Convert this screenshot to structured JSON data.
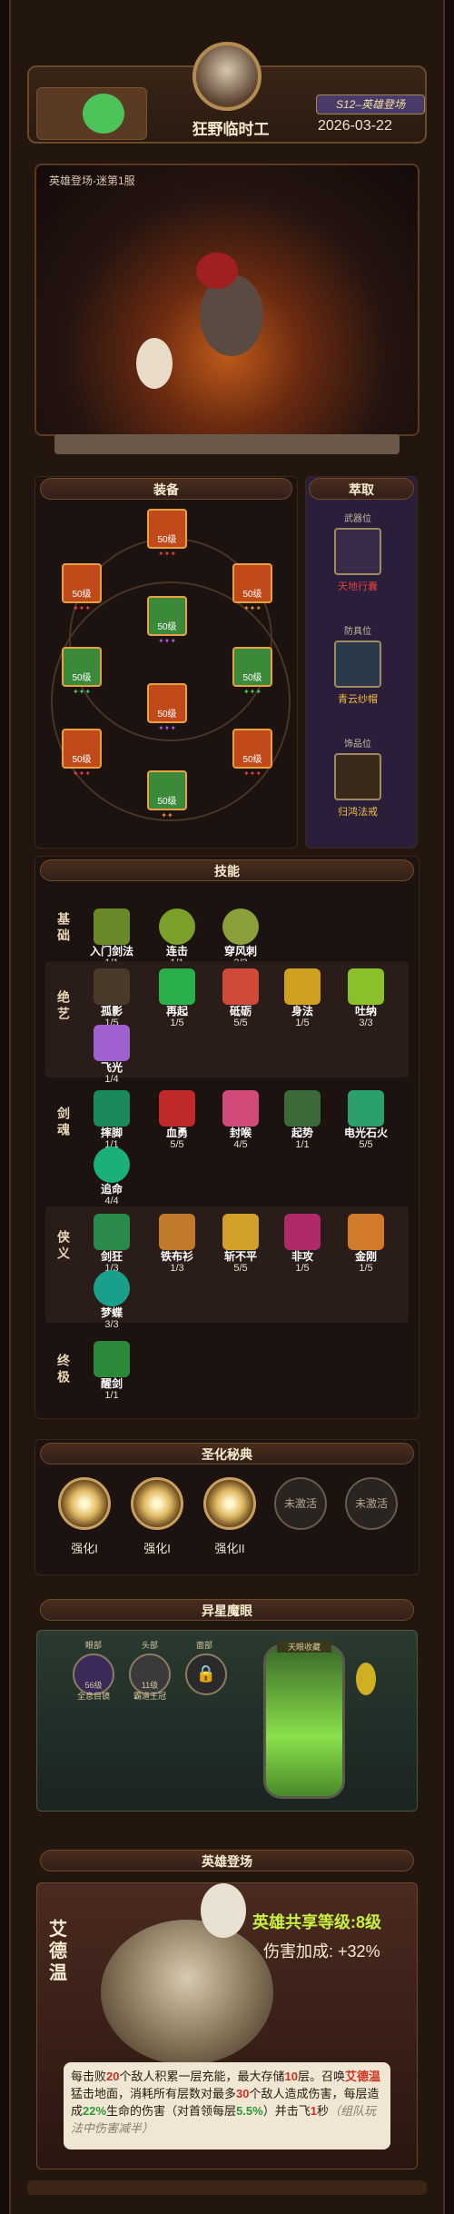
{
  "header": {
    "player_name": "狂野临时工",
    "date": "2026-03-22",
    "season_badge": "S12–英雄登场"
  },
  "stage": {
    "label": "英雄登场-迷第1服"
  },
  "equipment": {
    "title": "装备",
    "slots": [
      {
        "level": "50级",
        "gems": "✦✦✦",
        "gem_color": "red"
      },
      {
        "level": "50级",
        "gems": "✦✦✦",
        "gem_color": "red"
      },
      {
        "level": "50级",
        "gems": "✦✦✦",
        "gem_color": "orange"
      },
      {
        "level": "50级",
        "gems": "✦✦✦",
        "gem_color": "purple"
      },
      {
        "level": "50级",
        "gems": "✦✦✦",
        "gem_color": "green"
      },
      {
        "level": "50级",
        "gems": "✦✦✦",
        "gem_color": "green"
      },
      {
        "level": "50级",
        "gems": "✦✦✦",
        "gem_color": "purple"
      },
      {
        "level": "50级",
        "gems": "✦✦✦",
        "gem_color": "red"
      },
      {
        "level": "50级",
        "gems": "✦✦✦",
        "gem_color": "red"
      },
      {
        "level": "50级",
        "gems": "✦✦",
        "gem_color": "orange"
      }
    ]
  },
  "extract": {
    "title": "萃取",
    "items": [
      {
        "slot": "武器位",
        "name": "天地行囊"
      },
      {
        "slot": "防具位",
        "name": "青云纱帽"
      },
      {
        "slot": "饰品位",
        "name": "归鸿法戒"
      }
    ]
  },
  "skills": {
    "title": "技能",
    "rows": [
      {
        "label": "基础",
        "items": [
          {
            "name": "入门剑法",
            "level": "1/1"
          },
          {
            "name": "连击",
            "level": "1/1"
          },
          {
            "name": "穿风刺",
            "level": "3/3"
          }
        ]
      },
      {
        "label": "绝艺",
        "items": [
          {
            "name": "孤影",
            "level": "1/5"
          },
          {
            "name": "再起",
            "level": "1/5"
          },
          {
            "name": "砥砺",
            "level": "5/5"
          },
          {
            "name": "身法",
            "level": "1/5"
          },
          {
            "name": "吐纳",
            "level": "3/3"
          },
          {
            "name": "飞光",
            "level": "1/4"
          }
        ]
      },
      {
        "label": "剑魂",
        "items": [
          {
            "name": "摔脚",
            "level": "1/1"
          },
          {
            "name": "血勇",
            "level": "5/5"
          },
          {
            "name": "封喉",
            "level": "4/5"
          },
          {
            "name": "起势",
            "level": "1/1"
          },
          {
            "name": "电光石火",
            "level": "5/5"
          },
          {
            "name": "追命",
            "level": "4/4"
          }
        ]
      },
      {
        "label": "侠义",
        "items": [
          {
            "name": "剑狂",
            "level": "1/3"
          },
          {
            "name": "铁布衫",
            "level": "1/3"
          },
          {
            "name": "斩不平",
            "level": "5/5"
          },
          {
            "name": "非攻",
            "level": "1/5"
          },
          {
            "name": "金刚",
            "level": "1/5"
          },
          {
            "name": "梦蝶",
            "level": "3/3"
          }
        ]
      },
      {
        "label": "终极",
        "items": [
          {
            "name": "醒剑",
            "level": "1/1"
          }
        ]
      }
    ]
  },
  "codex": {
    "title": "圣化秘典",
    "items": [
      {
        "label": "强化I",
        "state": "on"
      },
      {
        "label": "强化I",
        "state": "on"
      },
      {
        "label": "强化II",
        "state": "on"
      },
      {
        "label": "未激活",
        "state": "off"
      },
      {
        "label": "未激活",
        "state": "off"
      }
    ]
  },
  "demon_eye": {
    "title": "异星魔眼",
    "slots": [
      {
        "tag": "眼部",
        "caption": "全息目镜",
        "level": "56级"
      },
      {
        "tag": "头部",
        "caption": "霸道王冠",
        "level": "11级"
      },
      {
        "tag": "面部",
        "caption": "",
        "level": ""
      }
    ],
    "tank_label": "天眼收藏"
  },
  "hero": {
    "title": "英雄登场",
    "name": "艾德温",
    "shared_level_label": "英雄共享等级:",
    "shared_level": "8级",
    "damage_label": "伤害加成:",
    "damage_bonus": "+32%",
    "desc_a": "每击败",
    "desc_b": "20",
    "desc_c": "个敌人积累一层充能，最大存储",
    "desc_d": "10",
    "desc_e": "层。召唤",
    "desc_f": "艾德温",
    "desc_g": "猛击地面，消耗所有层数对最多",
    "desc_h": "30",
    "desc_i": "个敌人造成伤害，每层造成",
    "desc_j": "22%",
    "desc_k": "生命的伤害（对首领每层",
    "desc_l": "5.5%",
    "desc_m": "）并击飞",
    "desc_n": "1",
    "desc_o": "秒",
    "desc_p": "（组队玩法中伤害减半）"
  }
}
